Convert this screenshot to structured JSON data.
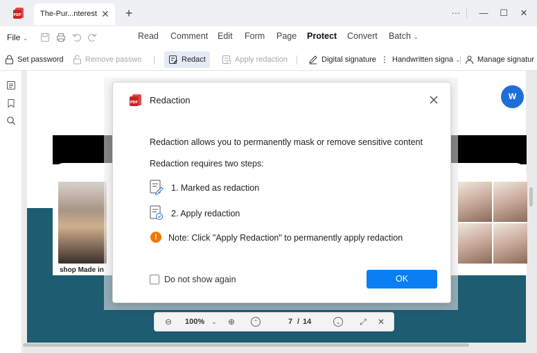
{
  "window": {
    "tab_title": "The-Pur...nterest",
    "close_glyph": "✕",
    "add_glyph": "+",
    "more_glyph": "···",
    "minimize_glyph": "—",
    "maximize_glyph": "☐",
    "window_close_glyph": "✕"
  },
  "menubar": {
    "file_label": "File",
    "file_chevron": "⌄",
    "items": [
      {
        "label": "Read"
      },
      {
        "label": "Comment"
      },
      {
        "label": "Edit"
      },
      {
        "label": "Form"
      },
      {
        "label": "Page"
      },
      {
        "label": "Protect",
        "active": true
      },
      {
        "label": "Convert"
      },
      {
        "label": "Batch"
      }
    ],
    "batch_chevron": "⌄"
  },
  "toolbar": {
    "set_password": "Set password",
    "remove_password": "Remove passwo",
    "redact": "Redact",
    "apply_redaction": "Apply redaction",
    "digital_signature": "Digital signature",
    "handwritten_signature": "Handwritten signa",
    "manage_signature": "Manage signatur",
    "chevron": "⌄"
  },
  "document": {
    "word_badge": "W",
    "caption": "shop Made in"
  },
  "pagebar": {
    "zoom": "100%",
    "zoom_chevron": "⌄",
    "page_current": "7",
    "page_total": "14",
    "page_separator": "/",
    "zoom_out_glyph": "⊖",
    "zoom_in_glyph": "⊕",
    "prev_glyph": "⌃",
    "next_glyph": "⌄",
    "fit_glyph": "⤢",
    "close_glyph": "✕"
  },
  "dialog": {
    "title": "Redaction",
    "description": "Redaction allows you to permanently mask or remove sensitive content",
    "steps_heading": "Redaction requires two steps:",
    "step1": "1. Marked as redaction",
    "step2": "2. Apply redaction",
    "note_glyph": "!",
    "note": "Note: Click \"Apply Redaction\" to permanently apply redaction",
    "checkbox_label": "Do not show again",
    "checkbox_checked": false,
    "ok_label": "OK"
  },
  "colors": {
    "accent": "#0a7ef2",
    "brand_red": "#d62b2b",
    "teal": "#1d5c71",
    "warning": "#f07800"
  }
}
